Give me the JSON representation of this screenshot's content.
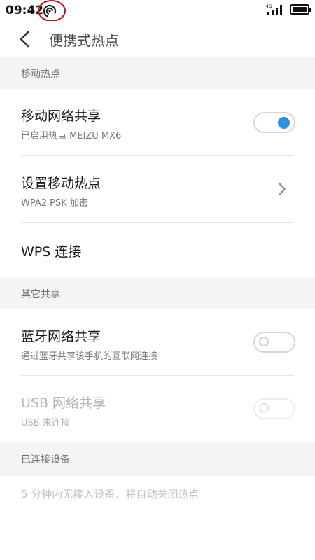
{
  "status_bar": {
    "time": "09:42",
    "network_label": "4G",
    "icons": [
      "hotspot-icon",
      "signal-icon",
      "battery-icon"
    ]
  },
  "header": {
    "title": "便携式热点",
    "back_icon": "back-arrow-icon"
  },
  "sections": {
    "mobile_hotspot": {
      "header": "移动热点",
      "items": [
        {
          "title": "移动网络共享",
          "subtitle": "已启用热点 MEIZU MX6",
          "toggle": true
        },
        {
          "title": "设置移动热点",
          "subtitle": "WPA2 PSK 加密",
          "icon": "chevron-right-icon"
        },
        {
          "title": "WPS 连接"
        }
      ]
    },
    "other_sharing": {
      "header": "其它共享",
      "items": [
        {
          "title": "蓝牙网络共享",
          "subtitle": "通过蓝牙共享该手机的互联网连接",
          "toggle": false
        },
        {
          "title": "USB 网络共享",
          "subtitle": "USB 未连接",
          "toggle": false,
          "disabled": true
        }
      ]
    },
    "connected_devices": {
      "header": "已连接设备",
      "empty_text": "5 分钟内无接入设备，将自动关闭热点"
    }
  },
  "colors": {
    "accent": "#2d8fe6",
    "annotation": "#c0101a",
    "section_bg": "#f4f4f4"
  }
}
